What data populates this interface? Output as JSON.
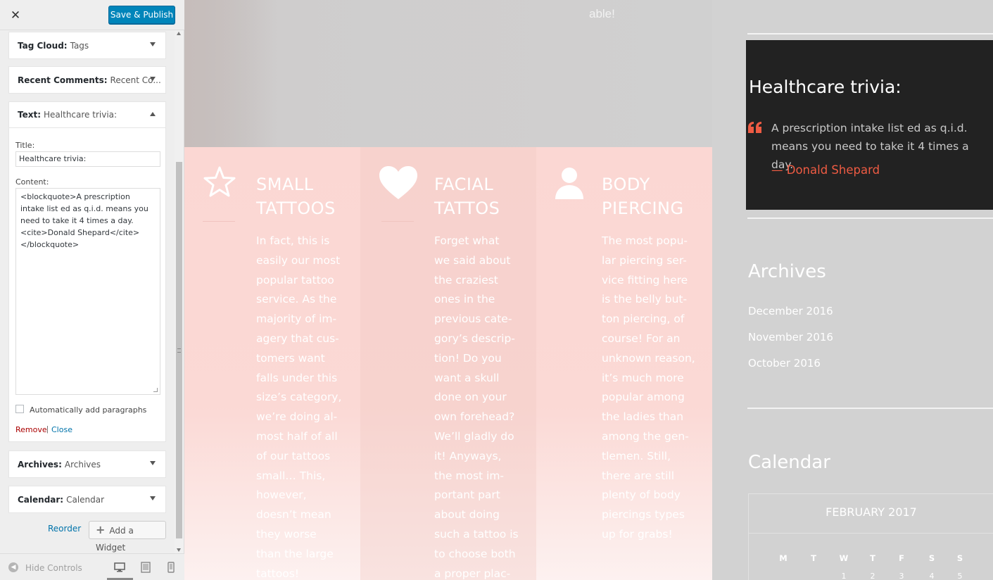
{
  "customizer": {
    "close_glyph": "✕",
    "save_publish": "Save & Publish",
    "widgets": [
      {
        "type": "Tag Cloud:",
        "name": "Tags"
      },
      {
        "type": "Recent Comments:",
        "name": "Recent Co..."
      },
      {
        "type": "Text:",
        "name": "Healthcare trivia:"
      },
      {
        "type": "Archives:",
        "name": "Archives"
      },
      {
        "type": "Calendar:",
        "name": "Calendar"
      }
    ],
    "text_widget": {
      "title_label": "Title:",
      "title_value": "Healthcare trivia:",
      "content_label": "Content:",
      "content_value": "<blockquote>A prescription intake list ed as q.i.d. means you need to take it 4 times a day.<cite>Donald Shepard</cite> </blockquote>",
      "auto_paragraphs_label": "Automatically add paragraphs",
      "auto_paragraphs_checked": false,
      "remove_label": "Remove",
      "separator": "|",
      "close_label": "Close"
    },
    "reorder_label": "Reorder",
    "add_widget_label": "Add a Widget",
    "hide_controls_label": "Hide Controls",
    "preview_devices": [
      "desktop",
      "tablet",
      "mobile"
    ],
    "active_device": "desktop"
  },
  "preview": {
    "hero_text": "able!",
    "services": [
      {
        "icon": "star-icon",
        "title": "SMALL TATTOOS",
        "body": "In fact, this is\neasily our most\npopular tattoo\nservice. As the\nmajority of im-\nagery that cus-\ntomers want\nfalls under this\nsize’s category,\nwe’re doing al-\nmost half of all\nof our tattoos\nsmall… This,\nhowever,\ndoesn’t mean\nthey worse\nthan the large\ntattoos!"
      },
      {
        "icon": "heart-icon",
        "title": "FACIAL TATTOS",
        "body": "Forget what\nwe said about\nthe craziest\nones in the\nprevious cate-\ngory’s descrip-\ntion! Do you\nwant a skull\ndone on your\nown forehead?\nWe’ll gladly do\nit! Anyways,\nthe most im-\nportant part\nabout doing\nsuch a tattoo is\nto choose both\na proper plac-"
      },
      {
        "icon": "person-icon",
        "title": "BODY PIERCING",
        "body": "The most popu-\nlar piercing ser-\nvice fitting here\nis the belly but-\nton piercing, of\ncourse!  For an\nunknown reason,\nit’s much more\npopular among\nthe ladies than\namong the gen-\ntlemen. Still,\nthere are still\nplenty of body\npiercings types\nup for grabs!"
      }
    ],
    "trivia": {
      "title": "Healthcare trivia:",
      "quote": "A prescription intake list ed as q.i.d. means you need to take it 4 times a day.",
      "cite": "— Donald Shepard"
    },
    "archives": {
      "title": "Archives",
      "items": [
        "December 2016",
        "November 2016",
        "October 2016"
      ]
    },
    "calendar": {
      "title": "Calendar",
      "caption": "FEBRUARY 2017",
      "weekdays": [
        "M",
        "T",
        "W",
        "T",
        "F",
        "S",
        "S"
      ],
      "first_row_days": [
        "",
        "",
        "1",
        "2",
        "3",
        "4",
        "5"
      ]
    }
  },
  "colors": {
    "accent_blue": "#0085ba",
    "quote_red": "#ee5b43",
    "services_bg": "#fbd7d3",
    "trivia_bg": "#222222"
  }
}
